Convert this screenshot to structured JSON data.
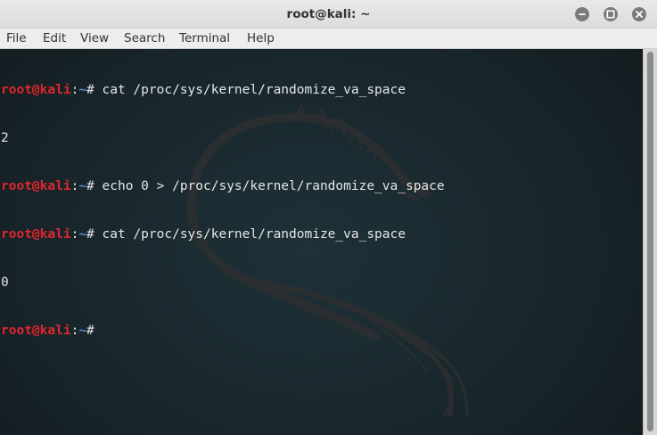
{
  "window": {
    "title": "root@kali: ~"
  },
  "menu": [
    "File",
    "Edit",
    "View",
    "Search",
    "Terminal",
    "Help"
  ],
  "terminal": {
    "lines": [
      {
        "type": "prompt",
        "user": "root@kali",
        "sep": ":",
        "path": "~",
        "symbol": "# ",
        "command": "cat /proc/sys/kernel/randomize_va_space"
      },
      {
        "type": "output",
        "text": "2"
      },
      {
        "type": "prompt",
        "user": "root@kali",
        "sep": ":",
        "path": "~",
        "symbol": "# ",
        "command": "echo 0 > /proc/sys/kernel/randomize_va_space"
      },
      {
        "type": "prompt",
        "user": "root@kali",
        "sep": ":",
        "path": "~",
        "symbol": "# ",
        "command": "cat /proc/sys/kernel/randomize_va_space"
      },
      {
        "type": "output",
        "text": "0"
      },
      {
        "type": "prompt",
        "user": "root@kali",
        "sep": ":",
        "path": "~",
        "symbol": "# ",
        "command": ""
      }
    ]
  },
  "icons": {
    "minimize": "minimize-icon",
    "maximize": "maximize-icon",
    "close": "close-icon",
    "background": "kali-dragon-icon"
  },
  "colors": {
    "prompt_user": "#e0262d",
    "prompt_path": "#5a86d8",
    "terminal_text": "#e6e6e6",
    "terminal_background": "#18262b"
  }
}
